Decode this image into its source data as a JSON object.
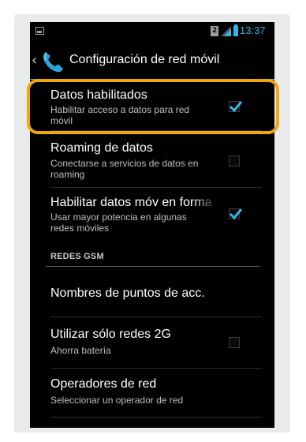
{
  "status_bar": {
    "sim_label": "2",
    "clock": "13:37",
    "icons": [
      "image-notification-icon",
      "sim-icon",
      "signal-icon",
      "battery-icon"
    ],
    "accent_color": "#33b5e5"
  },
  "action_bar": {
    "title": "Configuración de red móvil",
    "icons": [
      "back-chevron-icon",
      "phone-settings-icon"
    ]
  },
  "settings": [
    {
      "title": "Datos habilitados",
      "summary": "Habilitar acceso a datos para red móvil",
      "checked": true
    },
    {
      "title": "Roaming de datos",
      "summary": "Conectarse a servicios de datos en roaming",
      "checked": false
    },
    {
      "title": "Habilitar datos móv en forma",
      "summary": "Usar mayor potencia en algunas redes móviles",
      "checked": true
    }
  ],
  "section_gsm": {
    "header": "REDES GSM",
    "items": [
      {
        "title": "Nombres de puntos de acc."
      },
      {
        "title": "Utilizar sólo redes 2G",
        "summary": "Ahorra batería",
        "checked": false
      },
      {
        "title": "Operadores de red",
        "summary": "Seleccionar un operador de red"
      }
    ]
  },
  "highlight_color": "#f2a80c"
}
